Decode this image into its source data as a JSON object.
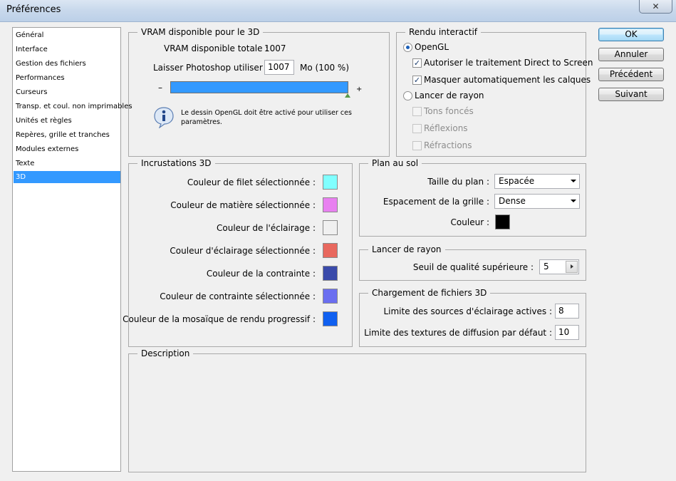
{
  "window": {
    "title": "Préférences",
    "close_glyph": "✕"
  },
  "sidebar": {
    "items": [
      {
        "label": "Général"
      },
      {
        "label": "Interface"
      },
      {
        "label": "Gestion des fichiers"
      },
      {
        "label": "Performances"
      },
      {
        "label": "Curseurs"
      },
      {
        "label": "Transp. et coul. non imprimables"
      },
      {
        "label": "Unités et règles"
      },
      {
        "label": "Repères, grille et tranches"
      },
      {
        "label": "Modules externes"
      },
      {
        "label": "Texte"
      },
      {
        "label": "3D"
      }
    ],
    "selected": "3D"
  },
  "vram": {
    "legend": "VRAM disponible pour le 3D",
    "total_label": "VRAM disponible totale :",
    "total_value": "1007",
    "use_label": "Laisser Photoshop utiliser :",
    "use_value": "1007",
    "use_unit": "Mo (100 %)",
    "slider_min": "–",
    "slider_max": "+",
    "slider_percent": 100,
    "info_icon": "info-icon",
    "info_text": "Le dessin OpenGL doit être activé pour utiliser ces paramètres."
  },
  "rendu": {
    "legend": "Rendu interactif",
    "opengl_label": "OpenGL",
    "opengl_selected": true,
    "direct_label": "Autoriser le traitement Direct to Screen",
    "direct_checked": true,
    "masquer_label": "Masquer automatiquement les calques",
    "masquer_checked": true,
    "lancer_label": "Lancer de rayon",
    "lancer_selected": false,
    "tons_label": "Tons foncés",
    "reflexions_label": "Réflexions",
    "refractions_label": "Réfractions",
    "check_glyph": "✓"
  },
  "incrustations": {
    "legend": "Incrustations 3D",
    "rows": [
      {
        "label": "Couleur de filet sélectionnée :",
        "color": "#80ffff"
      },
      {
        "label": "Couleur de matière sélectionnée :",
        "color": "#e880f0"
      },
      {
        "label": "Couleur de l'éclairage :",
        "color": "#f0f0f0"
      },
      {
        "label": "Couleur d'éclairage sélectionnée :",
        "color": "#e8685e"
      },
      {
        "label": "Couleur de la contrainte :",
        "color": "#3a4aaa"
      },
      {
        "label": "Couleur de contrainte sélectionnée :",
        "color": "#6a6ef0"
      },
      {
        "label": "Couleur de la mosaïque de rendu progressif :",
        "color": "#1060f0"
      }
    ]
  },
  "plan": {
    "legend": "Plan au sol",
    "taille_label": "Taille du plan :",
    "taille_value": "Espacée",
    "espacement_label": "Espacement de la grille :",
    "espacement_value": "Dense",
    "couleur_label": "Couleur :",
    "couleur_value": "#000000"
  },
  "lancer": {
    "legend": "Lancer de rayon",
    "seuil_label": "Seuil de qualité supérieure :",
    "seuil_value": "5"
  },
  "chargement": {
    "legend": "Chargement de fichiers 3D",
    "limite_ecl_label": "Limite des sources d'éclairage actives :",
    "limite_ecl_value": "8",
    "limite_tex_label": "Limite des textures de diffusion par défaut :",
    "limite_tex_value": "10"
  },
  "description": {
    "legend": "Description",
    "text": ""
  },
  "buttons": {
    "ok": "OK",
    "annuler": "Annuler",
    "precedent": "Précédent",
    "suivant": "Suivant"
  }
}
